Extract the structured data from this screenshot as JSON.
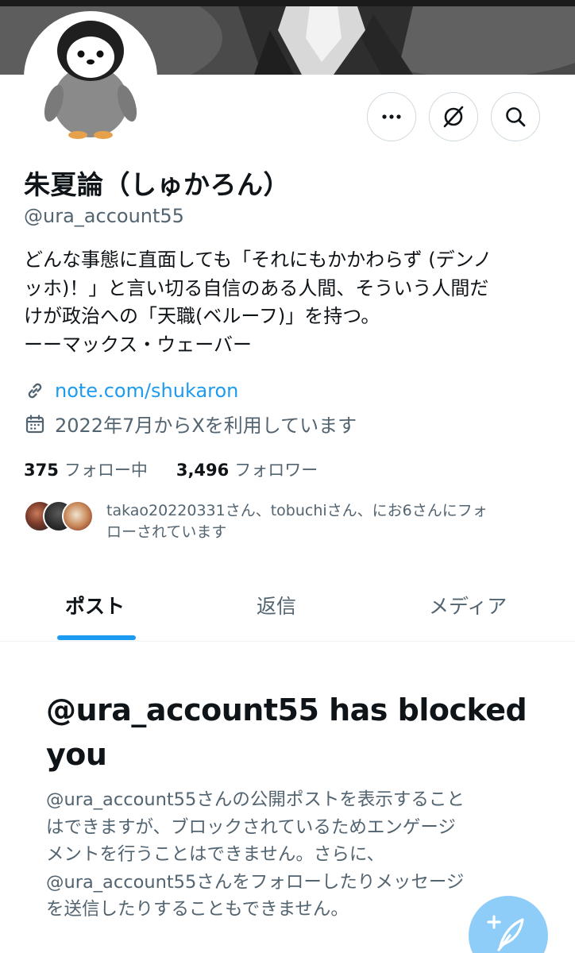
{
  "profile": {
    "display_name": "朱夏論（しゅかろん）",
    "handle": "@ura_account55",
    "bio_lines": [
      "どんな事態に直面しても「それにもかかわらず (デンノ",
      "ッホ)！」と言い切る自信のある人間、そういう人間だ",
      "けが政治への「天職(ベルーフ)」を持つ。",
      "ーーマックス・ウェーバー"
    ],
    "link": "note.com/shukaron",
    "joined": "2022年7月からXを利用しています",
    "following_count": "375",
    "following_label": "フォロー中",
    "followers_count": "3,496",
    "followers_label": "フォロワー",
    "followed_by_lines": [
      "takao20220331さん、tobuchiさん、にお6さんにフォ",
      "ローされています"
    ]
  },
  "icons": {
    "more": "more-horizontal-icon",
    "grok": "grok-icon",
    "search": "search-icon",
    "link": "link-icon",
    "calendar": "calendar-icon",
    "compose": "compose-post-icon"
  },
  "tabs": [
    {
      "label": "ポスト",
      "active": true
    },
    {
      "label": "返信",
      "active": false
    },
    {
      "label": "メディア",
      "active": false
    }
  ],
  "blocked": {
    "title_lines": [
      "@ura_account55 has blocked",
      "you"
    ],
    "body_lines": [
      "@ura_account55さんの公開ポストを表示すること",
      "はできますが、ブロックされているためエンゲージ",
      "メントを行うことはできません。さらに、",
      "@ura_account55さんをフォローしたりメッセージ",
      "を送信したりすることもできません。"
    ]
  },
  "colors": {
    "accent": "#1d9bf0",
    "text_primary": "#0f1419",
    "text_secondary": "#536471",
    "fab_background": "#8ecdf8"
  }
}
